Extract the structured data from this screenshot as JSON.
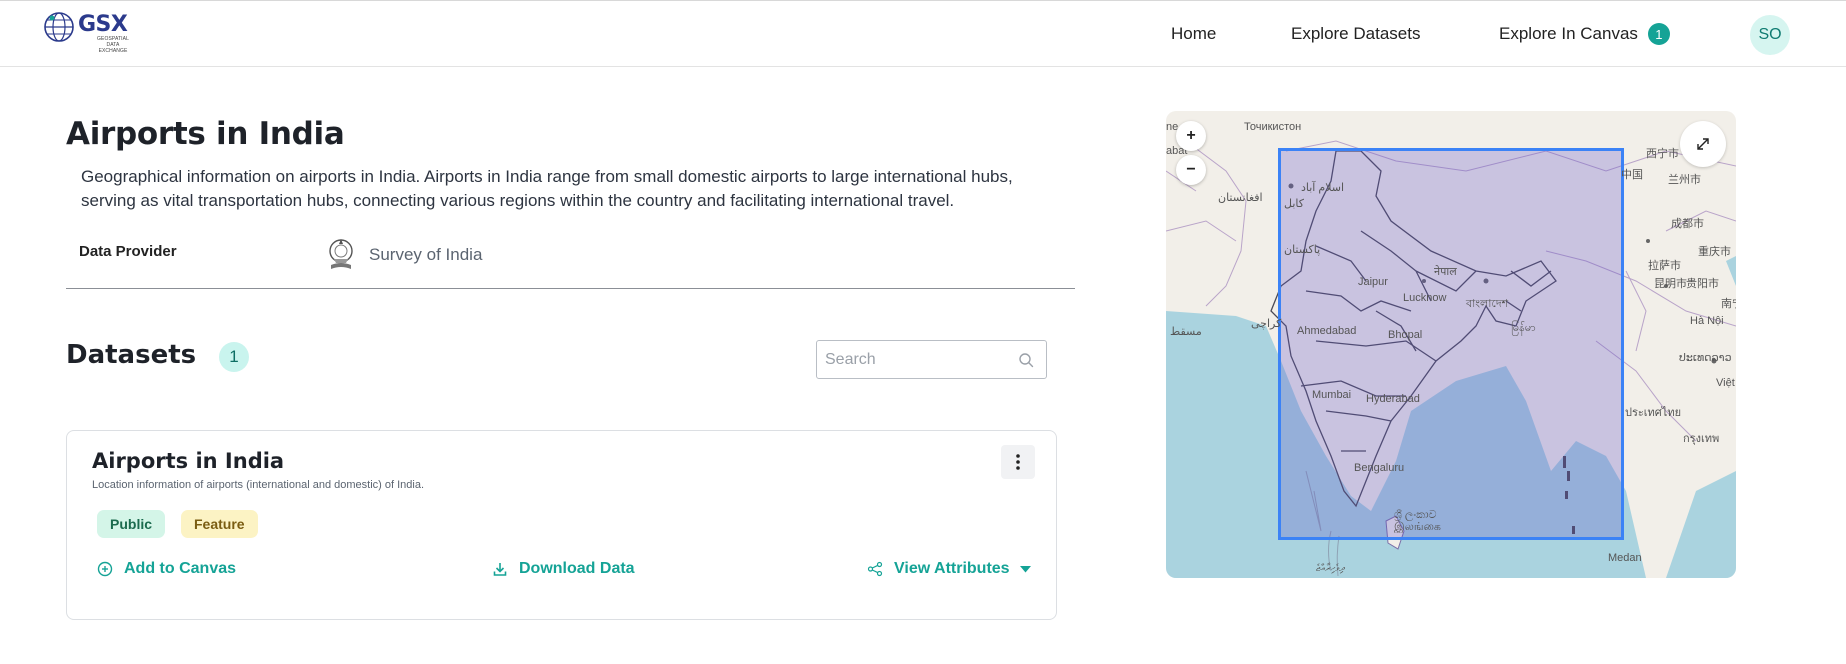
{
  "header": {
    "logo_text": "GSX",
    "logo_tagline": "GEOSPATIAL DATA EXCHANGE",
    "nav": [
      {
        "label": "Home"
      },
      {
        "label": "Explore Datasets"
      },
      {
        "label": "Explore In Canvas",
        "badge": "1"
      }
    ],
    "avatar_initials": "SO",
    "accent_color": "#15a396"
  },
  "page": {
    "title": "Airports in India",
    "description": "Geographical information on airports in India. Airports in India range from small domestic airports to large international hubs, serving as vital transportation hubs, connecting various regions within the country and facilitating international travel.",
    "provider_label": "Data Provider",
    "provider_name": "Survey of India"
  },
  "datasets": {
    "title": "Datasets",
    "count": "1",
    "search_placeholder": "Search",
    "search_value": "",
    "items": [
      {
        "title": "Airports in India",
        "description": "Location information of airports (international and domestic) of India.",
        "tags": [
          "Public",
          "Feature"
        ],
        "actions": {
          "add": "Add to Canvas",
          "download": "Download Data",
          "view": "View Attributes"
        }
      }
    ]
  },
  "map": {
    "zoom_in": "+",
    "zoom_out": "−",
    "labels": {
      "tajik": "Точикистон",
      "afghan": "افغانستان",
      "kabul": "کابل",
      "islamabad": "اسلام آباد",
      "pakistan": "پاکستان",
      "karachi": "کراچی",
      "muscat": "مسقط",
      "nepal": "नेपाल",
      "jaipur": "Jaipur",
      "lucknow": "Lucknow",
      "ahmedabad": "Ahmedabad",
      "bhopal": "Bhopal",
      "mumbai": "Mumbai",
      "hyderabad": "Hyderabad",
      "bengaluru": "Bengaluru",
      "lanka": "ශ්‍රී ලංකාව இலங்கை",
      "maldives": "ދިވެހިރާއްޖެ",
      "china": "中国",
      "xining": "西宁市",
      "lanzhou": "兰州市",
      "chengdu": "成都市",
      "chongqing": "重庆市",
      "lhasa": "拉萨市",
      "kunming": "昆明市",
      "guiyang": "贵阳市",
      "hanoi": "Hà Nội",
      "vietnam": "Việt",
      "nanning": "南宁",
      "medan": "Medan",
      "thailand": "ประเทศไทย",
      "laos": "ປະເທດລາວ",
      "bangkok": "กรุงเทพ",
      "myanmar": "မြန်မာ",
      "bangladesh": "বাংলাদেশ",
      "edge_abat": "abat",
      "edge_ne": "ne"
    }
  }
}
